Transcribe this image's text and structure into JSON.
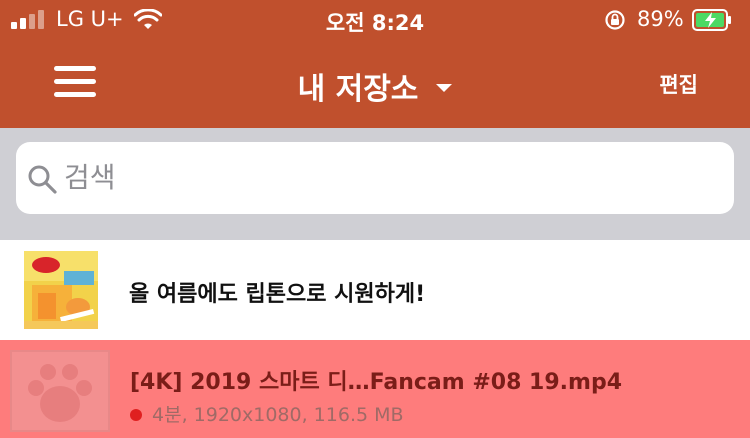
{
  "status_bar": {
    "carrier": "LG U+",
    "time": "오전 8:24",
    "battery_percent": "89%",
    "battery_level": 0.89,
    "charging": true
  },
  "navbar": {
    "title": "내 저장소",
    "edit_label": "편집",
    "icons": [
      "hamburger-menu-icon",
      "chevron-down-icon"
    ]
  },
  "search": {
    "placeholder": "검색",
    "value": ""
  },
  "ad": {
    "text": "올 여름에도 립톤으로 시원하게!"
  },
  "files": [
    {
      "name": "[4K] 2019 스마트 디…Fancam #08 19.mp4",
      "meta": "4분, 1920x1080, 116.5 MB",
      "status_color": "#e02020"
    }
  ],
  "colors": {
    "header": "#c0502d",
    "search_bg": "#cfcfd4",
    "selected_row": "#fe7c7c",
    "battery_fill": "#4cd964"
  }
}
